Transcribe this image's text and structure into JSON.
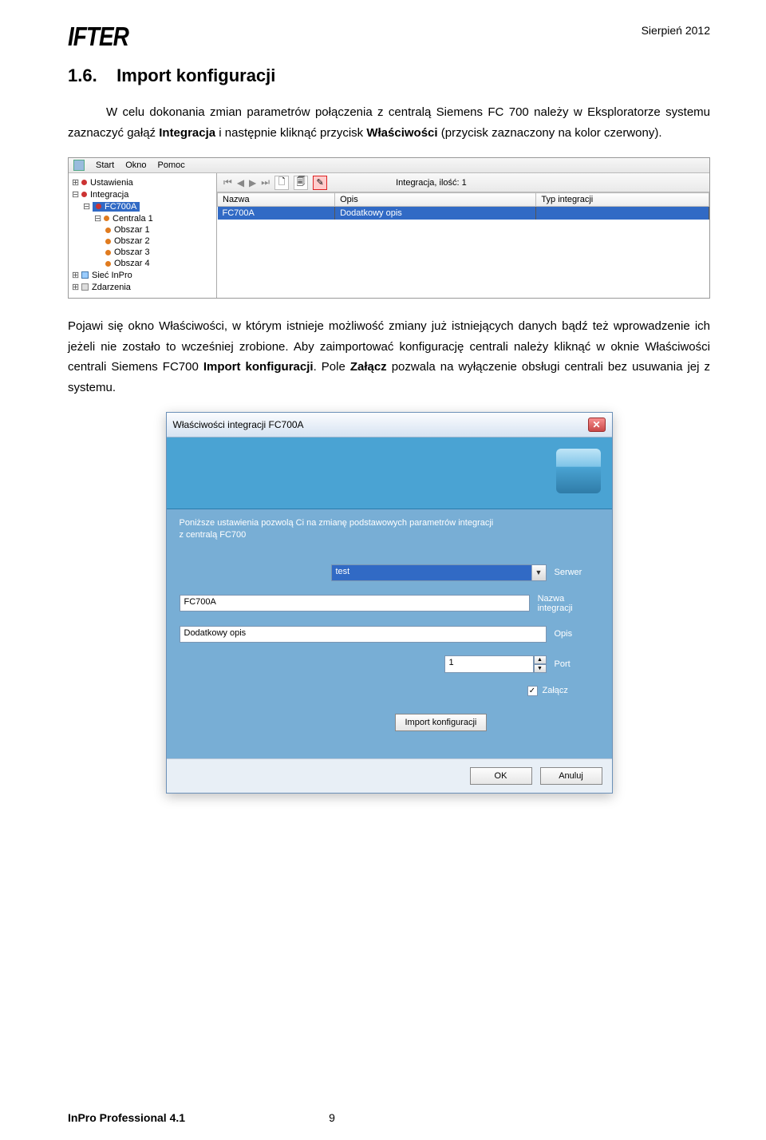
{
  "header": {
    "logo": "IFTER",
    "date": "Sierpień 2012"
  },
  "section": {
    "number": "1.6.",
    "title": "Import konfiguracji"
  },
  "para1_parts": {
    "a": "W celu dokonania zmian parametrów połączenia z centralą Siemens FC 700 należy w Eksploratorze systemu zaznaczyć gałąź ",
    "b": "Integracja",
    "c": " i następnie kliknąć przycisk ",
    "d": "Właściwości",
    "e": " (przycisk zaznaczony na kolor czerwony)."
  },
  "para2_parts": {
    "a": "Pojawi się okno Właściwości, w którym istnieje możliwość zmiany już istniejących danych bądź też wprowadzenie ich jeżeli nie zostało to wcześniej zrobione. Aby zaimportować konfigurację centrali należy kliknąć w oknie Właściwości centrali Siemens FC700 ",
    "b": "Import konfiguracji",
    "c": ". Pole ",
    "d": "Załącz",
    "e": " pozwala na wyłączenie obsługi centrali bez usuwania jej z systemu."
  },
  "ss1": {
    "menu": [
      "Start",
      "Okno",
      "Pomoc"
    ],
    "tree": {
      "ustawienia": "Ustawienia",
      "integracja": "Integracja",
      "fc700a": "FC700A",
      "centrala": "Centrala 1",
      "obszar1": "Obszar 1",
      "obszar2": "Obszar 2",
      "obszar3": "Obszar 3",
      "obszar4": "Obszar 4",
      "siec": "Sieć InPro",
      "zdarzenia": "Zdarzenia"
    },
    "toolbar_count": "Integracja, ilość: 1",
    "grid": {
      "headers": [
        "Nazwa",
        "Opis",
        "Typ integracji"
      ],
      "row": [
        "FC700A",
        "Dodatkowy opis",
        ""
      ]
    }
  },
  "ss2": {
    "title": "Właściwości integracji FC700A",
    "desc_line1": "Poniższe ustawienia pozwolą Ci na zmianę podstawowych parametrów integracji",
    "desc_line2": "z centralą FC700",
    "server_value": "test",
    "server_label": "Serwer",
    "name_value": "FC700A",
    "name_label": "Nazwa integracji",
    "opis_value": "Dodatkowy opis",
    "opis_label": "Opis",
    "port_value": "1",
    "port_label": "Port",
    "zalacz_label": "Załącz",
    "import_label": "Import konfiguracji",
    "ok": "OK",
    "cancel": "Anuluj"
  },
  "footer": {
    "product": "InPro Professional 4.1",
    "page": "9"
  }
}
